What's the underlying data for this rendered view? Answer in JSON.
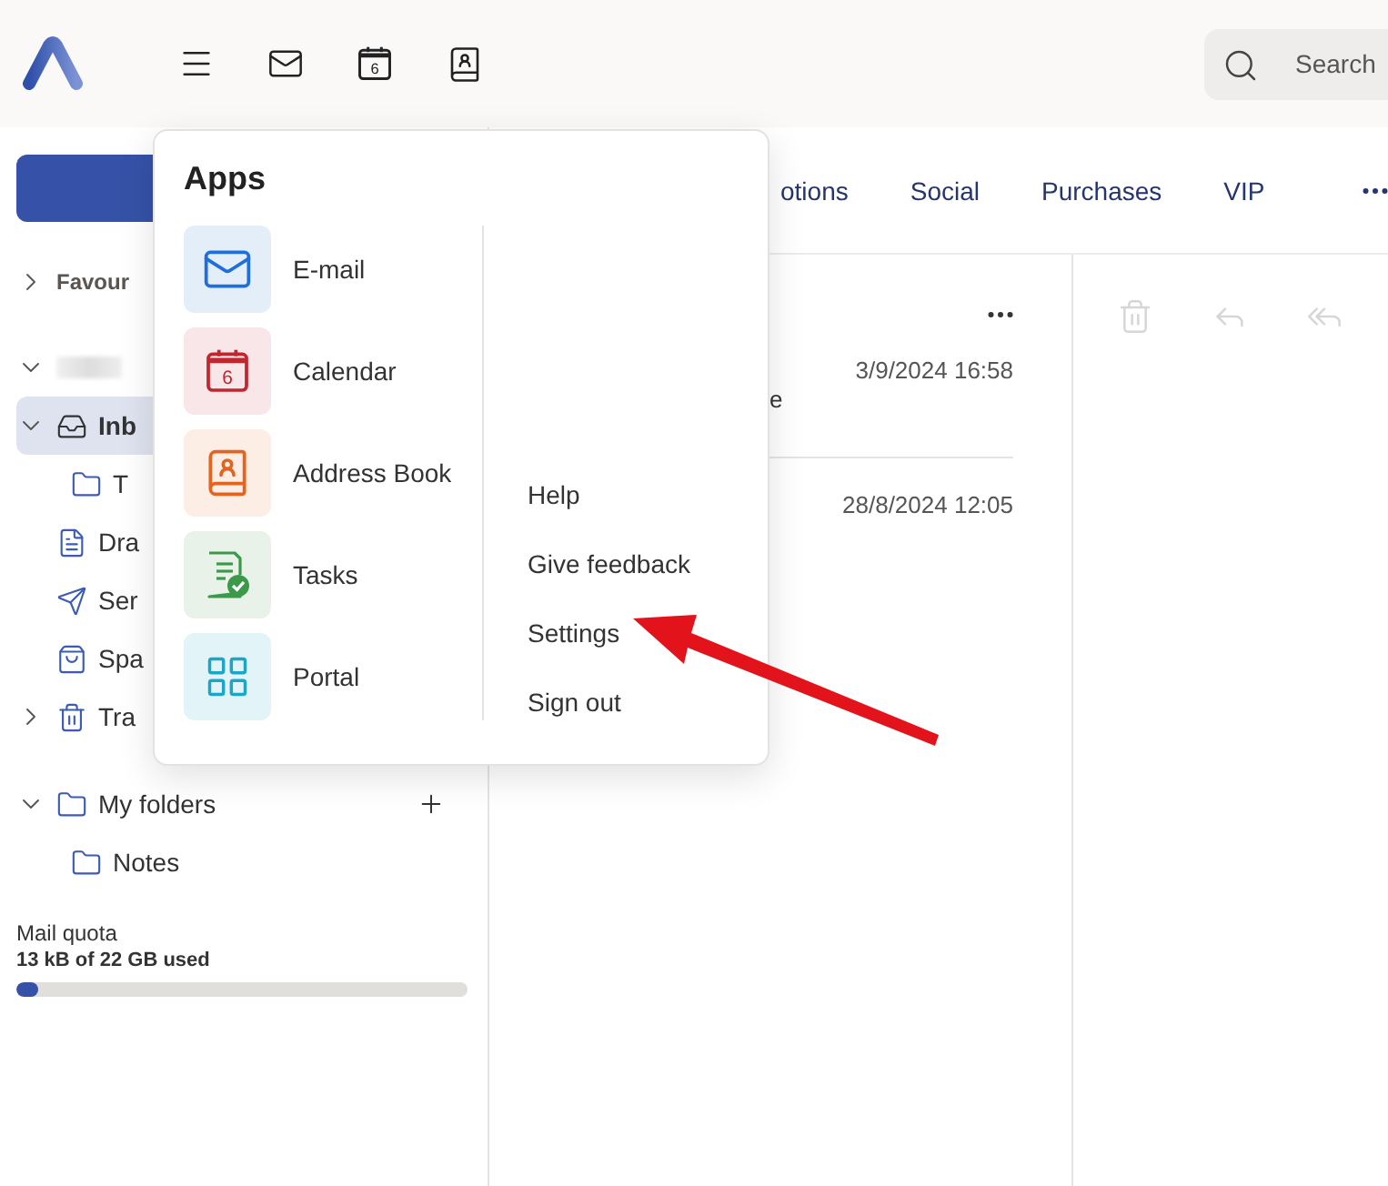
{
  "header": {
    "calendar_day": "6"
  },
  "search": {
    "placeholder": "Search"
  },
  "sidebar": {
    "favourites": {
      "label": "Favour",
      "expanded": false
    },
    "account": {
      "expanded": true,
      "folders": [
        {
          "label": "Inb",
          "kind": "inbox",
          "expanded": true,
          "selected": true,
          "children": [
            {
              "label": "T",
              "kind": "folder",
              "selected": false
            }
          ]
        },
        {
          "label": "Dra",
          "kind": "drafts",
          "selected": false
        },
        {
          "label": "Ser",
          "kind": "sent",
          "selected": false
        },
        {
          "label": "Spa",
          "kind": "spam",
          "selected": false
        },
        {
          "label": "Tra",
          "kind": "trash",
          "expanded": false,
          "selected": false
        }
      ]
    },
    "my_folders": {
      "label": "My folders",
      "expanded": true,
      "children": [
        {
          "label": "Notes",
          "kind": "folder",
          "selected": false
        }
      ]
    },
    "quota": {
      "label": "Mail quota",
      "usage": "13 kB of 22 GB used",
      "level": 0.05
    }
  },
  "tabs": [
    {
      "label": "otions",
      "selected": false
    },
    {
      "label": "Social",
      "selected": false
    },
    {
      "label": "Purchases",
      "selected": false
    },
    {
      "label": "VIP",
      "selected": false
    }
  ],
  "messages": [
    {
      "date": "3/9/2024 16:58",
      "preview": "e"
    },
    {
      "date": "28/8/2024 12:05"
    }
  ],
  "reading_toolbar": [
    {
      "kind": "delete",
      "disabled": true
    },
    {
      "kind": "reply",
      "disabled": true
    },
    {
      "kind": "reply_all",
      "disabled": true
    }
  ],
  "apps_menu": {
    "title": "Apps",
    "apps": [
      {
        "label": "E-mail",
        "kind": "mail"
      },
      {
        "label": "Calendar",
        "kind": "calendar",
        "day": "6"
      },
      {
        "label": "Address Book",
        "kind": "contacts"
      },
      {
        "label": "Tasks",
        "kind": "tasks"
      },
      {
        "label": "Portal",
        "kind": "portal"
      }
    ],
    "links": [
      "Help",
      "Give feedback",
      "Settings",
      "Sign out"
    ]
  },
  "annotation": {
    "kind": "arrow"
  }
}
